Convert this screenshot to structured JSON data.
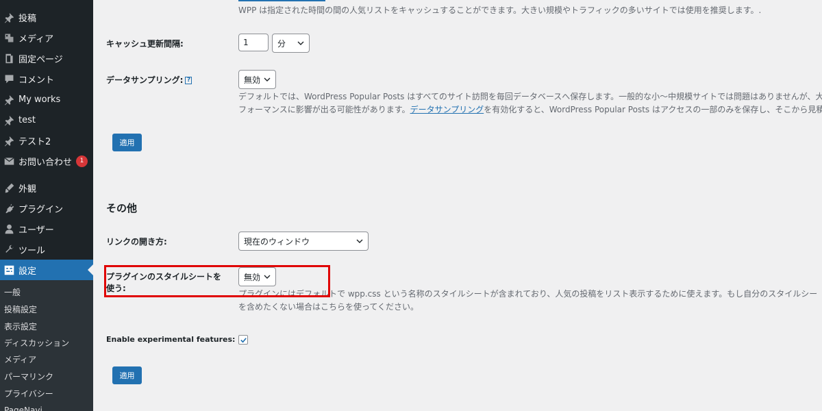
{
  "sidebar": {
    "items": [
      {
        "label": "投稿",
        "icon": "pin-icon"
      },
      {
        "label": "メディア",
        "icon": "media-icon"
      },
      {
        "label": "固定ページ",
        "icon": "page-icon"
      },
      {
        "label": "コメント",
        "icon": "comment-icon"
      },
      {
        "label": "My works",
        "icon": "pin-icon"
      },
      {
        "label": "test",
        "icon": "pin-icon"
      },
      {
        "label": "テスト2",
        "icon": "pin-icon"
      },
      {
        "label": "お問い合わせ",
        "icon": "mail-icon",
        "badge": "1"
      },
      {
        "label": "外観",
        "icon": "brush-icon"
      },
      {
        "label": "プラグイン",
        "icon": "plugin-icon"
      },
      {
        "label": "ユーザー",
        "icon": "user-icon"
      },
      {
        "label": "ツール",
        "icon": "wrench-icon"
      },
      {
        "label": "設定",
        "icon": "settings-icon",
        "current": true
      }
    ],
    "submenu": [
      "一般",
      "投稿設定",
      "表示設定",
      "ディスカッション",
      "メディア",
      "パーマリンク",
      "プライバシー",
      "PageNavi"
    ]
  },
  "main": {
    "cache_desc": "WPP は指定された時間の間の人気リストをキャッシュすることができます。大きい規模やトラフィックの多いサイトでは使用を推奨します。.",
    "cache_interval_label": "キャッシュ更新間隔:",
    "cache_interval_value": "1",
    "cache_interval_unit": "分",
    "sampling_label": "データサンプリング:",
    "sampling_help": "?",
    "sampling_value": "無効",
    "sampling_desc_line1": "デフォルトでは、WordPress Popular Posts はすべてのサイト訪問を毎回データベースへ保存します。一般的な小～中規模サイトでは問題はありませんが、大",
    "sampling_desc_line2_pre": "フォーマンスに影響が出る可能性があります。",
    "sampling_desc_link": "データサンプリング",
    "sampling_desc_line2_post": "を有効化すると、WordPress Popular Posts はアクセスの一部のみを保存し、そこから見積",
    "apply_label_1": "適用",
    "other_section_title": "その他",
    "link_open_label": "リンクの開き方:",
    "link_open_value": "現在のウィンドウ",
    "stylesheet_label_line1": "プラグインのスタイルシートを",
    "stylesheet_label_line2": "使う:",
    "stylesheet_value": "無効",
    "stylesheet_desc_line1": "プラグインにはデフォルトで wpp.css という名称のスタイルシートが含まれており、人気の投稿をリスト表示するために使えます。もし自分のスタイルシー",
    "stylesheet_desc_line2": "を含めたくない場合はこちらを使ってください。",
    "experimental_label": "Enable experimental features:",
    "experimental_checked": true,
    "apply_label_2": "適用"
  },
  "colors": {
    "sidebar_bg": "#1d2327",
    "accent": "#2271b1",
    "highlight": "#e00000",
    "badge": "#d63638"
  }
}
